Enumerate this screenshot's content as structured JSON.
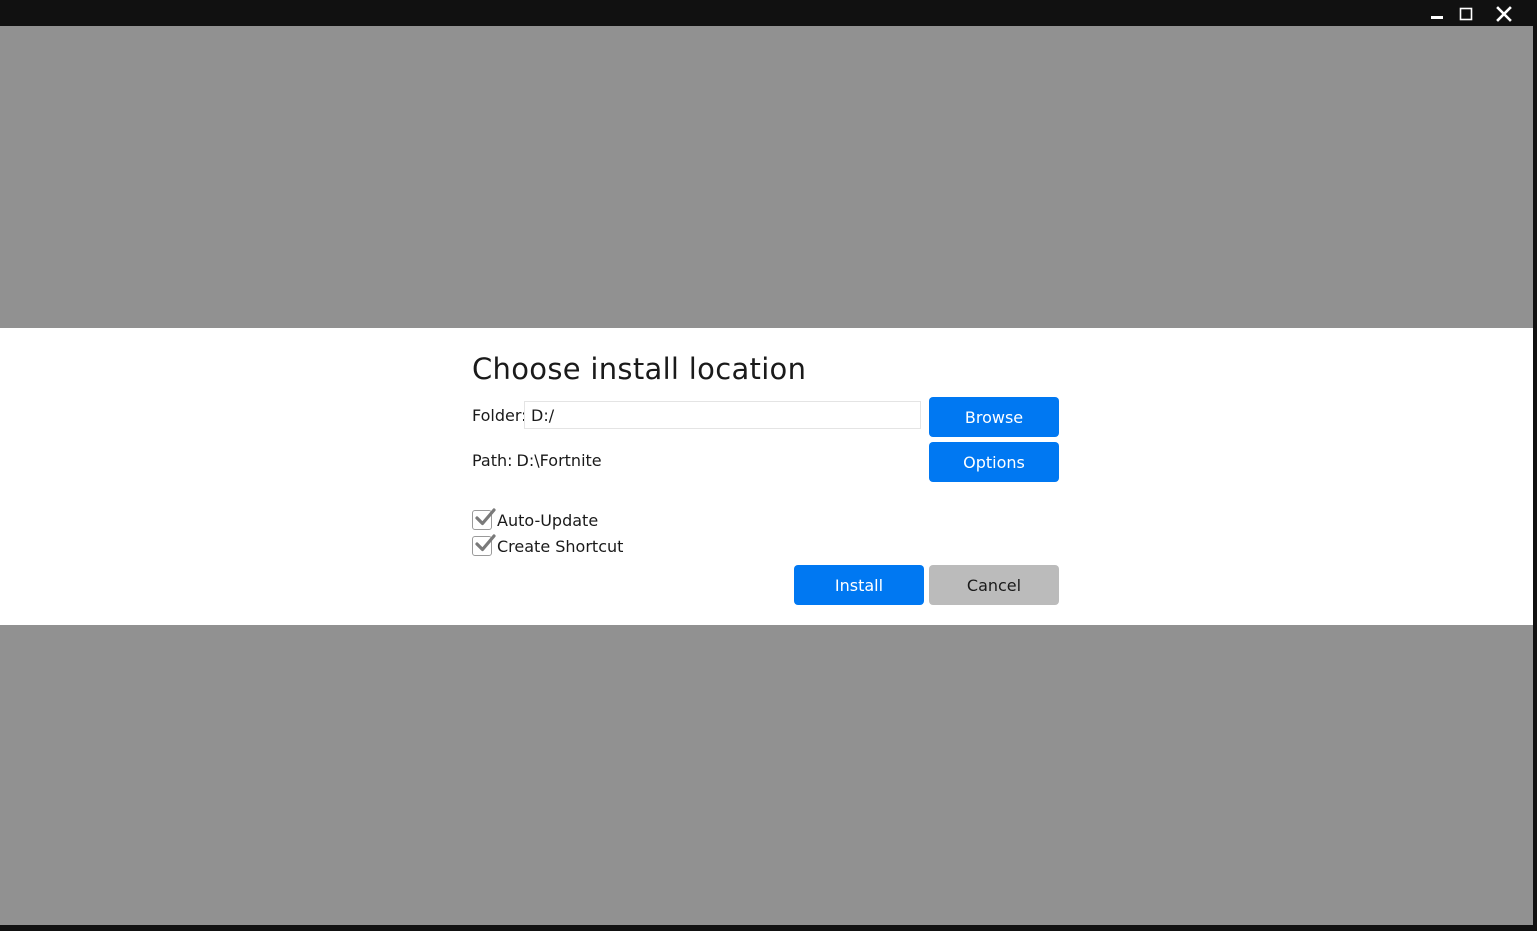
{
  "window": {
    "controls": {
      "minimize_icon": "minimize-icon",
      "maximize_icon": "maximize-icon",
      "close_icon": "close-icon"
    }
  },
  "dialog": {
    "title": "Choose install location",
    "folder_label": "Folder:",
    "folder_value": "D:/",
    "path_label": "Path:",
    "path_value": "D:\\Fortnite",
    "browse_label": "Browse",
    "options_label": "Options",
    "checkboxes": [
      {
        "label": "Auto-Update",
        "checked": true
      },
      {
        "label": "Create Shortcut",
        "checked": true
      }
    ],
    "install_label": "Install",
    "cancel_label": "Cancel"
  },
  "colors": {
    "accent": "#0078f2",
    "secondary_button": "#bbbbbb",
    "overlay": "#919191",
    "titlebar": "#111111"
  }
}
